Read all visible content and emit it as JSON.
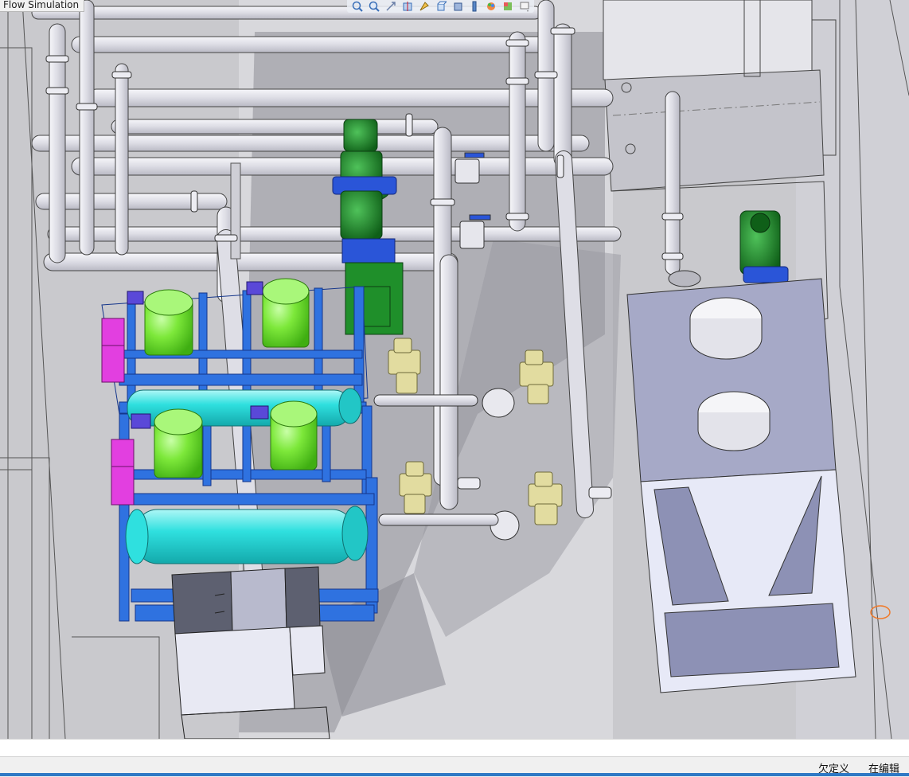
{
  "window": {
    "tab_label": "Flow Simulation"
  },
  "view_toolbar": {
    "icons": [
      "zoom-to-fit-icon",
      "zoom-to-area-icon",
      "previous-view-icon",
      "section-view-icon",
      "dynamic-annotation-icon",
      "view-orientation-icon",
      "display-style-icon",
      "hide-show-items-icon",
      "edit-appearance-icon",
      "apply-scene-icon",
      "view-settings-icon"
    ]
  },
  "scene": {
    "background_color": "#c9c9cd",
    "pipe_color": "#e8e8ee",
    "tank_green": "#7de83a",
    "tank_cyan": "#2fe0df",
    "frame_blue": "#2f72e0",
    "pump_green": "#1f8f2a",
    "magenta_panel": "#e23fe0",
    "chiller_body": "#a6a9c7",
    "valve_yellow": "#e2dca0"
  },
  "status_bar": {
    "left_text": "",
    "underdefined": "欠定义",
    "editing": "在编辑"
  }
}
